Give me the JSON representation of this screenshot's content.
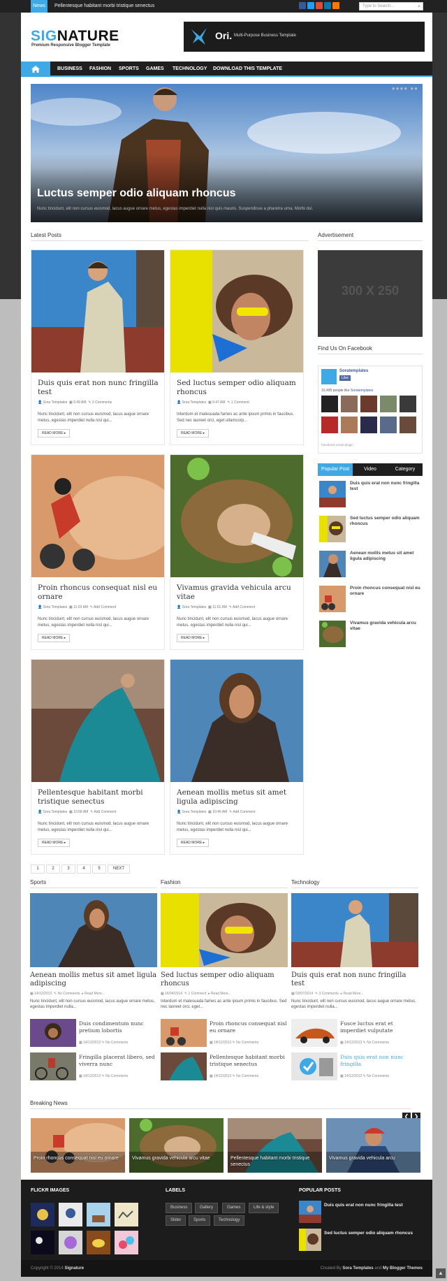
{
  "topbar": {
    "news_label": "News",
    "ticker_text": "Pellentesque habitant morbi tristique senectus",
    "search_placeholder": "Type to Search...",
    "social": [
      "facebook-icon",
      "twitter-icon",
      "googleplus-icon",
      "linkedin-icon",
      "soundcloud-icon"
    ],
    "social_colors": [
      "#3b5998",
      "#1da1f2",
      "#dd4b39",
      "#0e76a8",
      "#ff7700"
    ]
  },
  "header": {
    "logo_sig": "SIG",
    "logo_rest": "NATURE",
    "tagline": "Premium Responsive Blogger Template",
    "banner_title": "Ori.",
    "banner_sub": "Multi-Purpose Business Template"
  },
  "nav": [
    "BUSINESS",
    "FASHION",
    "SPORTS",
    "GAMES",
    "TECHNOLOGY",
    "DOWNLOAD THIS TEMPLATE"
  ],
  "slider": {
    "title": "Luctus semper odio aliquam rhoncus",
    "desc": "Nunc tincidunt, elit non cursus euismod, lacus augue ornare metus, egestas imperdiet nulla nisl quis mauris. Suspendisse a pharetra urna. Morbi dui."
  },
  "latest": {
    "heading": "Latest Posts",
    "read_more": "READ MORE ▸",
    "posts": [
      {
        "title": "Duis quis erat non nunc fringilla test",
        "author": "Sora Templates",
        "time": "6:49 AM",
        "comments": "3 Comments",
        "excerpt": "Nunc tincidunt, elit non cursus euismod, lacus augue ornare metus, egestas imperdiet nulla nisl qui..."
      },
      {
        "title": "Sed luctus semper odio aliquam rhoncus",
        "author": "Sora Templates",
        "time": "6:47 AM",
        "comments": "1 Comment",
        "excerpt": "Interdum et malesuada fames ac ante ipsum primis in faucibus. Sed nec laoreet orci, eget ullamcorp..."
      },
      {
        "title": "Proin rhoncus consequat nisl eu ornare",
        "author": "Sora Templates",
        "time": "11:03 AM",
        "comments": "Add Comment",
        "excerpt": "Nunc tincidunt, elit non cursus euismod, lacus augue ornare metus, egestas imperdiet nulla nisl qui..."
      },
      {
        "title": "Vivamus gravida vehicula arcu vitae",
        "author": "Sora Templates",
        "time": "11:01 AM",
        "comments": "Add Comment",
        "excerpt": "Nunc tincidunt, elit non cursus euismod, lacus augue ornare metus, egestas imperdiet nulla nisl qui..."
      },
      {
        "title": "Pellentesque habitant morbi tristique senectus",
        "author": "Sora Templates",
        "time": "10:58 AM",
        "comments": "Add Comment",
        "excerpt": "Nunc tincidunt, elit non cursus euismod, lacus augue ornare metus, egestas imperdiet nulla nisl qui..."
      },
      {
        "title": "Aenean mollis metus sit amet ligula adipiscing",
        "author": "Sora Templates",
        "time": "10:46 AM",
        "comments": "Add Comment",
        "excerpt": "Nunc tincidunt, elit non cursus euismod, lacus augue ornare metus, egestas imperdiet nulla nisl qui..."
      }
    ]
  },
  "pagination": [
    "1",
    "2",
    "3",
    "4",
    "5",
    "NEXT"
  ],
  "sidebar": {
    "ad_heading": "Advertisement",
    "ad_text": "300 X 250",
    "fb_heading": "Find Us On Facebook",
    "fb_page": "Soratemplates",
    "fb_like": "Like",
    "fb_people": "10,495 people like",
    "fb_people_link": "Soratemplates",
    "fb_plugin": "Facebook social plugin",
    "tabs": [
      "Popular Post",
      "Video",
      "Category"
    ],
    "popular": [
      "Duis quis erat non nunc fringilla test",
      "Sed luctus semper odio aliquam rhoncus",
      "Aenean mollis metus sit amet ligula adipiscing",
      "Proin rhoncus consequat nisl eu ornare",
      "Vivamus gravida vehicula arcu vitae"
    ]
  },
  "categories": [
    {
      "heading": "Sports",
      "title": "Aenean mollis metus sit amet ligula adipiscing",
      "date": "14/12/2013",
      "comments": "No Comments",
      "read": "Read More...",
      "excerpt": "Nunc tincidunt, elit non cursus euismod, lacus augue ornare metus, egestas imperdiet nulla...",
      "minis": [
        {
          "title": "Duis condimentum nunc pretium lobortis",
          "date": "14/12/2013",
          "comments": "No Comments"
        },
        {
          "title": "Fringilla placerat libero, sed viverra nunc",
          "date": "14/12/2013",
          "comments": "No Comments"
        }
      ]
    },
    {
      "heading": "Fashion",
      "title": "Sed luctus semper odio aliquam rhoncus",
      "date": "16/04/2014",
      "comments": "1 Comment",
      "read": "Read More...",
      "excerpt": "Interdum et malesuada fames ac ante ipsum primis in faucibus. Sed nec laoreet orci, eget...",
      "minis": [
        {
          "title": "Proin rhoncus consequat nisl eu ornare",
          "date": "14/12/2013",
          "comments": "No Comments"
        },
        {
          "title": "Pellentesque habitant morbi tristique senectus",
          "date": "14/12/2013",
          "comments": "No Comments"
        }
      ]
    },
    {
      "heading": "Technology",
      "title": "Duis quis erat non nunc fringilla test",
      "date": "03/07/2014",
      "comments": "3 Comments",
      "read": "Read More...",
      "excerpt": "Nunc tincidunt, elit non cursus euismod, lacus augue ornare metus, egestas imperdiet nulla...",
      "minis": [
        {
          "title": "Fusce luctus erat et imperdiet vulputate",
          "date": "14/12/2013",
          "comments": "No Comments"
        },
        {
          "title": "Duis quis erat non nunc fringilla",
          "date": "14/12/2013",
          "comments": "No Comments"
        }
      ]
    }
  ],
  "breaking": {
    "heading": "Breaking News",
    "prev": "❮",
    "next": "❯",
    "items": [
      "Proin rhoncus consequat nisl eu ornare",
      "Vivamus gravida vehicula arcu vitae",
      "Pellentesque habitant morbi tristique senectus",
      "Vivamus gravida vehicula arcu"
    ]
  },
  "footer": {
    "flickr_heading": "FLICKR IMAGES",
    "labels_heading": "LABELS",
    "labels": [
      "Business",
      "Gallery",
      "Games",
      "Life & style",
      "Slider",
      "Sports",
      "Technology"
    ],
    "popular_heading": "POPULAR POSTS",
    "popular": [
      "Duis quis erat non nunc fringilla test",
      "Sed luctus semper odio aliquam rhoncus"
    ],
    "copyright_prefix": "Copyright © 2014",
    "copyright_name": "Signature",
    "credit_prefix": "Created By",
    "credit_a": "Sora Templates",
    "credit_mid": "and",
    "credit_b": "My Blogger Themes"
  },
  "colors": {
    "accent": "#3fa9e5",
    "dark": "#1c1c1c"
  }
}
